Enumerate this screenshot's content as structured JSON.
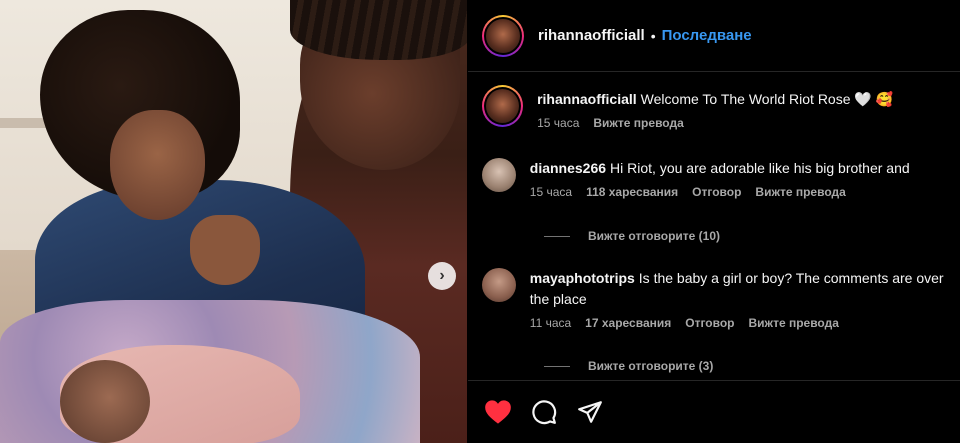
{
  "post": {
    "image_alt": "Photo of a family with a newborn baby",
    "carousel_next_glyph": "›"
  },
  "header": {
    "username": "rihannaofficiall",
    "separator": "•",
    "follow_label": "Последване"
  },
  "caption": {
    "username": "rihannaofficiall",
    "text": "Welcome To The World Riot Rose 🤍 🥰",
    "time": "15 часа",
    "translate": "Вижте превода"
  },
  "comments": [
    {
      "username": "diannes266",
      "text": "Hi Riot, you are adorable like his big brother and",
      "time": "15 часа",
      "likes": "118 харесвания",
      "reply": "Отговор",
      "translate": "Вижте превода",
      "view_replies": "Вижте отговорите (10)"
    },
    {
      "username": "mayaphototrips",
      "text": "Is the baby a girl or boy? The comments are over the place",
      "time": "11 часа",
      "likes": "17 харесвания",
      "reply": "Отговор",
      "translate": "Вижте превода",
      "view_replies": "Вижте отговорите (3)"
    }
  ],
  "actions": {
    "like_icon": "heart-icon",
    "comment_icon": "comment-icon",
    "share_icon": "share-icon",
    "like_state": "liked"
  },
  "colors": {
    "background": "#000000",
    "follow": "#3897f0",
    "like": "#ff3040",
    "muted_text": "#a8a8a8"
  }
}
